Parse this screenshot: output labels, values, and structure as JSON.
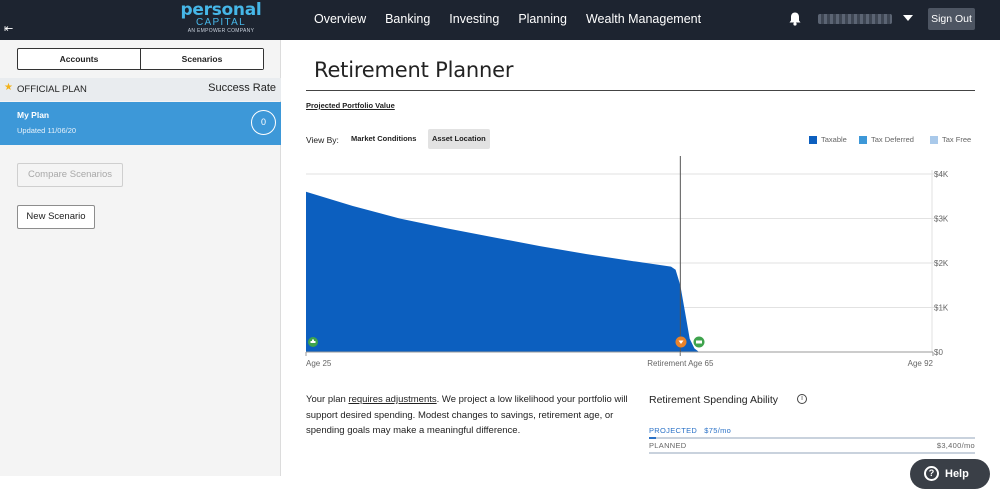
{
  "logo": {
    "line1": "personal",
    "line2": "CAPITAL",
    "line3": "AN EMPOWER COMPANY"
  },
  "nav": {
    "items": [
      "Overview",
      "Banking",
      "Investing",
      "Planning",
      "Wealth Management"
    ],
    "sign_out": "Sign Out"
  },
  "sidebar": {
    "tabs": [
      "Accounts",
      "Scenarios"
    ],
    "active_tab": "Scenarios",
    "plan_header": {
      "label": "OFFICIAL PLAN",
      "rate_label": "Success Rate"
    },
    "plan": {
      "name": "My Plan",
      "updated": "Updated 11/06/20",
      "success_rate": "0"
    },
    "compare_button": "Compare Scenarios",
    "new_button": "New Scenario"
  },
  "main": {
    "title": "Retirement Planner",
    "section_link": "Projected Portfolio Value",
    "view_by": {
      "label": "View By:",
      "options": [
        "Market Conditions",
        "Asset Location"
      ],
      "selected": "Asset Location"
    },
    "legend": [
      {
        "label": "Taxable",
        "color": "#0c5fbf"
      },
      {
        "label": "Tax Deferred",
        "color": "#3d98d8"
      },
      {
        "label": "Tax Free",
        "color": "#a9c9ea"
      }
    ],
    "advice": {
      "before": "Your plan ",
      "link": "requires adjustments",
      "after": ". We project a low likelihood your portfolio will support desired spending. Modest changes to savings, retirement age, or spending goals may make a meaningful difference."
    },
    "spending": {
      "title": "Retirement Spending Ability",
      "projected_label": "PROJECTED",
      "projected_amount": "$75/mo",
      "planned_label": "PLANNED",
      "planned_amount": "$3,400/mo",
      "projected_fraction": 0.022
    }
  },
  "help": {
    "label": "Help"
  },
  "chart_data": {
    "type": "area",
    "x_tick_labels": [
      "Age 25",
      "Retirement Age 65",
      "Age 92"
    ],
    "y_tick_labels": [
      "$0",
      "$1K",
      "$2K",
      "$3K",
      "$4K"
    ],
    "xlim": [
      25,
      92
    ],
    "ylim": [
      0,
      4000
    ],
    "grid": true,
    "retirement_marker": 65,
    "series": [
      {
        "name": "Taxable",
        "color": "#0c5fbf",
        "x": [
          25,
          30,
          35,
          40,
          45,
          50,
          55,
          60,
          64,
          64.5,
          65,
          65.5,
          66,
          66.5,
          67
        ],
        "values": [
          3600,
          3280,
          3000,
          2780,
          2580,
          2380,
          2200,
          2040,
          1920,
          1850,
          1500,
          900,
          300,
          80,
          0
        ]
      }
    ],
    "colors": {
      "fill": "#0c5fbf",
      "grid": "#e2e2e2",
      "axis": "#999999",
      "marker_line": "#555555"
    }
  }
}
